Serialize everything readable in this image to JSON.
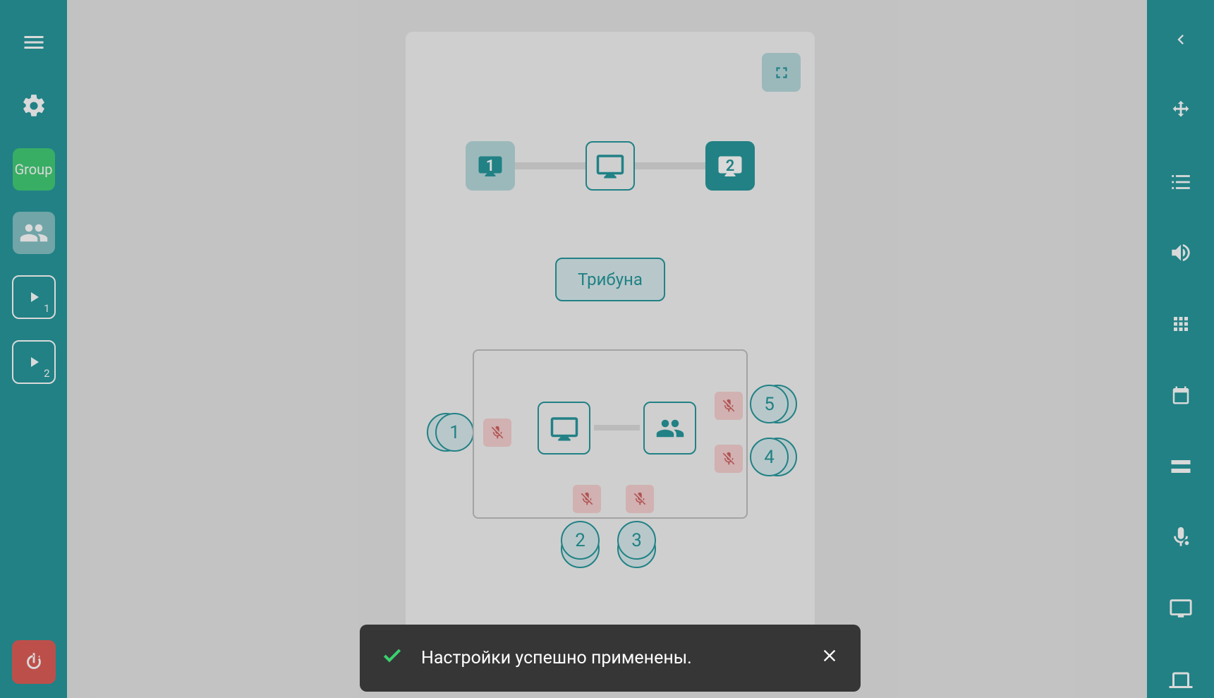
{
  "left_sidebar": {
    "group_label": "Group",
    "play1_badge": "1",
    "play2_badge": "2"
  },
  "center": {
    "top_monitor_1": "1",
    "top_monitor_2": "2",
    "tribune_label": "Трибуна",
    "seats": {
      "s1": "1",
      "s2": "2",
      "s3": "3",
      "s4": "4",
      "s5": "5"
    }
  },
  "toast": {
    "message": "Настройки успешно применены."
  },
  "colors": {
    "primary": "#00868b",
    "success": "#21c45d",
    "danger": "#d9413a",
    "mute_bg": "#f4c8c8",
    "seat_bg": "#d1e8ea"
  }
}
